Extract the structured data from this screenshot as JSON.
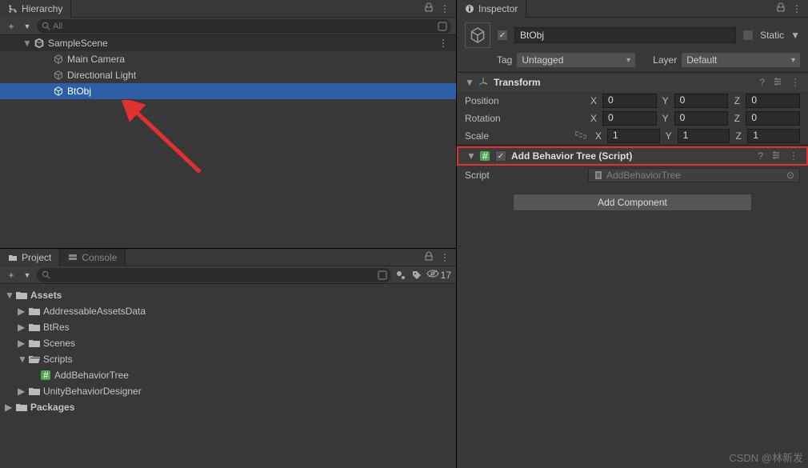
{
  "hierarchy": {
    "tab": "Hierarchy",
    "search_placeholder": "All",
    "scene": "SampleScene",
    "items": [
      "Main Camera",
      "Directional Light",
      "BtObj"
    ],
    "selected_index": 2
  },
  "project": {
    "tab_project": "Project",
    "tab_console": "Console",
    "visible_count": "17",
    "tree": {
      "root0": "Assets",
      "children0": [
        "AddressableAssetsData",
        "BtRes",
        "Scenes",
        "Scripts",
        "UnityBehaviorDesigner"
      ],
      "scripts_child": "AddBehaviorTree",
      "root1": "Packages"
    }
  },
  "inspector": {
    "tab": "Inspector",
    "go_name": "BtObj",
    "static_label": "Static",
    "tag_label": "Tag",
    "tag_value": "Untagged",
    "layer_label": "Layer",
    "layer_value": "Default",
    "transform": {
      "title": "Transform",
      "position_label": "Position",
      "rotation_label": "Rotation",
      "scale_label": "Scale",
      "position": {
        "x": "0",
        "y": "0",
        "z": "0"
      },
      "rotation": {
        "x": "0",
        "y": "0",
        "z": "0"
      },
      "scale": {
        "x": "1",
        "y": "1",
        "z": "1"
      },
      "axis": {
        "x": "X",
        "y": "Y",
        "z": "Z"
      }
    },
    "script_comp": {
      "title": "Add Behavior Tree (Script)",
      "field_label": "Script",
      "field_value": "AddBehaviorTree"
    },
    "add_component": "Add Component"
  },
  "watermark": "CSDN @林新发"
}
